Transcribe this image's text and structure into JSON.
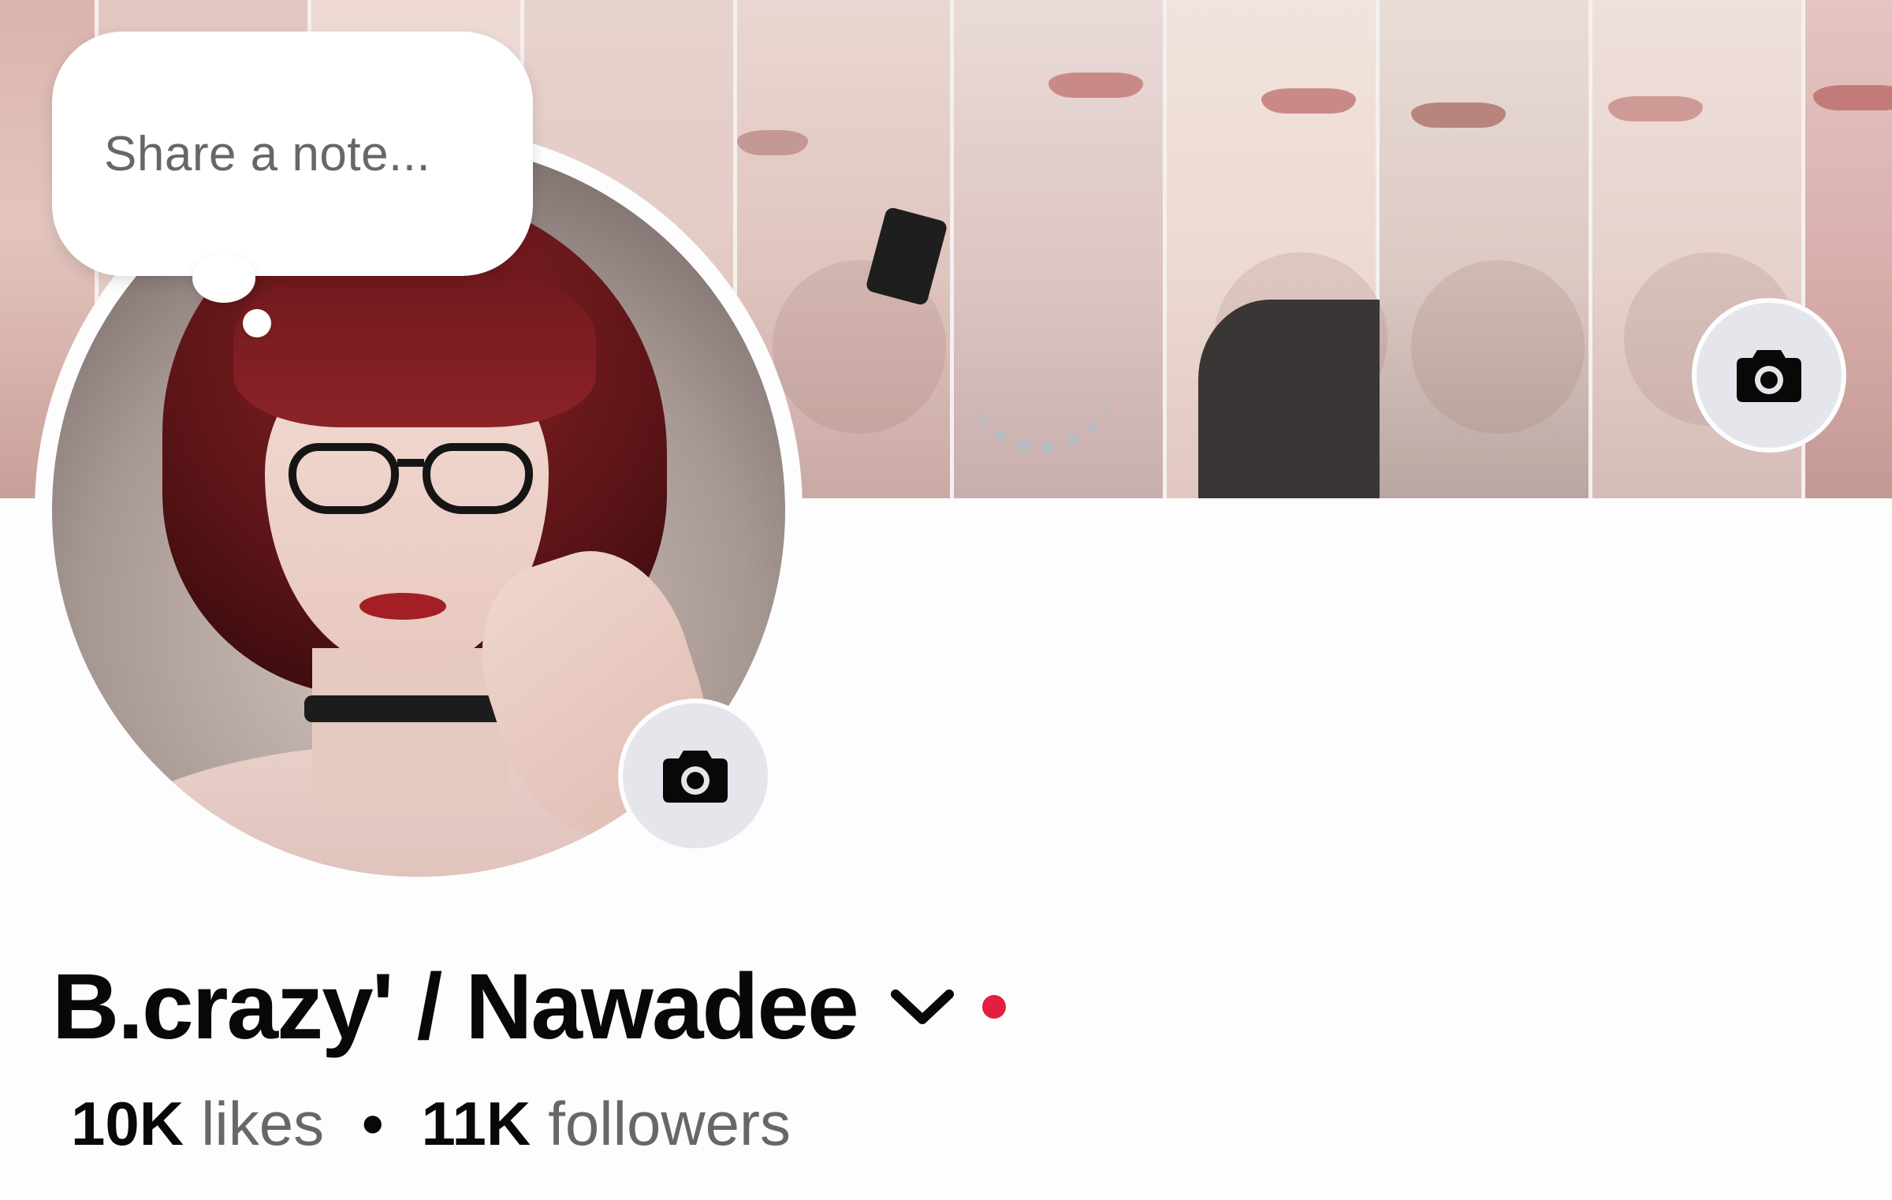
{
  "note": {
    "placeholder": "Share a note..."
  },
  "profile": {
    "name": "B.crazy' / Nawadee",
    "likes_count": "10K",
    "likes_label": "likes",
    "separator": "•",
    "followers_count": "11K",
    "followers_label": "followers"
  },
  "icons": {
    "cover_camera": "camera-icon",
    "avatar_camera": "camera-icon",
    "name_dropdown": "chevron-down-icon"
  },
  "colors": {
    "text_primary": "#080809",
    "text_secondary": "#65676b",
    "button_bg": "#e4e6eb",
    "status_dot": "#e41e3f"
  }
}
